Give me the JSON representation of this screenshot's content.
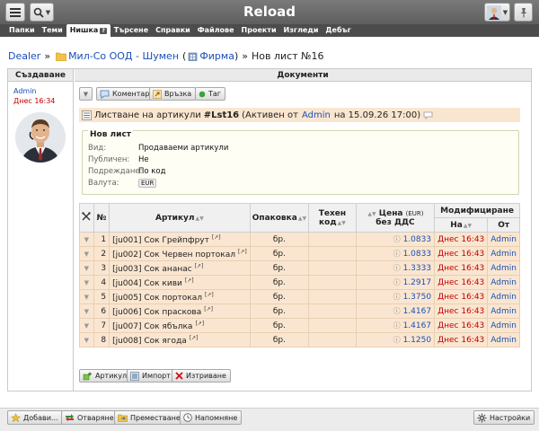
{
  "app": {
    "title": "Reload"
  },
  "nav": {
    "tabs": [
      {
        "label": "Папки"
      },
      {
        "label": "Теми"
      },
      {
        "label": "Нишка",
        "badge": "?"
      },
      {
        "label": "Търсене"
      },
      {
        "label": "Справки"
      },
      {
        "label": "Файлове"
      },
      {
        "label": "Проекти"
      },
      {
        "label": "Изгледи"
      },
      {
        "label": "Дебъг"
      }
    ]
  },
  "breadcrumb": {
    "root": "Dealer",
    "folder": "Мил-Со ООД - Шумен",
    "folder_tag": "Фирма",
    "current": "Нов лист №16"
  },
  "left": {
    "header": "Създаване",
    "creator": "Admin",
    "created": "Днес 16:34"
  },
  "right": {
    "header": "Документи",
    "buttons": {
      "comment": "Коментар",
      "link": "Връзка",
      "tag": "Таг"
    }
  },
  "listing": {
    "prefix": "Листване на артикули",
    "code": "#Lst16",
    "status_pre": "(Активен от",
    "user": "Admin",
    "status_post": "на 15.09.26 17:00)"
  },
  "details": {
    "legend": "Нов лист",
    "rows": [
      {
        "label": "Вид:",
        "value": "Продаваеми артикули"
      },
      {
        "label": "Публичен:",
        "value": "Не"
      },
      {
        "label": "Подреждане:",
        "value": "По код"
      },
      {
        "label": "Валута:",
        "value": "EUR"
      }
    ]
  },
  "table": {
    "headers": {
      "no": "№",
      "article": "Артикул",
      "pack": "Опаковка",
      "techcode": "Техен код",
      "price_pre": "Цена",
      "price_cur": "(EUR)",
      "price_post": "без ДДС",
      "modified": "Модифициране",
      "on": "На",
      "from": "От"
    },
    "rows": [
      {
        "no": "1",
        "article": "[ju001] Сок Грейпфрут",
        "pack": "бр.",
        "techcode": "",
        "price": "1.0833",
        "date": "Днес 16:43",
        "user": "Admin"
      },
      {
        "no": "2",
        "article": "[ju002] Сок Червен портокал",
        "pack": "бр.",
        "techcode": "",
        "price": "1.0833",
        "date": "Днес 16:43",
        "user": "Admin"
      },
      {
        "no": "3",
        "article": "[ju003] Сок ананас",
        "pack": "бр.",
        "techcode": "",
        "price": "1.3333",
        "date": "Днес 16:43",
        "user": "Admin"
      },
      {
        "no": "4",
        "article": "[ju004] Сок киви",
        "pack": "бр.",
        "techcode": "",
        "price": "1.2917",
        "date": "Днес 16:43",
        "user": "Admin"
      },
      {
        "no": "5",
        "article": "[ju005] Сок портокал",
        "pack": "бр.",
        "techcode": "",
        "price": "1.3750",
        "date": "Днес 16:43",
        "user": "Admin"
      },
      {
        "no": "6",
        "article": "[ju006] Сок праскова",
        "pack": "бр.",
        "techcode": "",
        "price": "1.4167",
        "date": "Днес 16:43",
        "user": "Admin"
      },
      {
        "no": "7",
        "article": "[ju007] Сок ябълка",
        "pack": "бр.",
        "techcode": "",
        "price": "1.4167",
        "date": "Днес 16:43",
        "user": "Admin"
      },
      {
        "no": "8",
        "article": "[ju008] Сок ягода",
        "pack": "бр.",
        "techcode": "",
        "price": "1.1250",
        "date": "Днес 16:43",
        "user": "Admin"
      }
    ]
  },
  "actions": {
    "article": "Артикул",
    "import": "Импорт",
    "delete": "Изтриване"
  },
  "bottom": {
    "add": "Добави...",
    "open": "Отваряне",
    "move": "Преместване",
    "remind": "Напомняне",
    "settings": "Настройки"
  }
}
